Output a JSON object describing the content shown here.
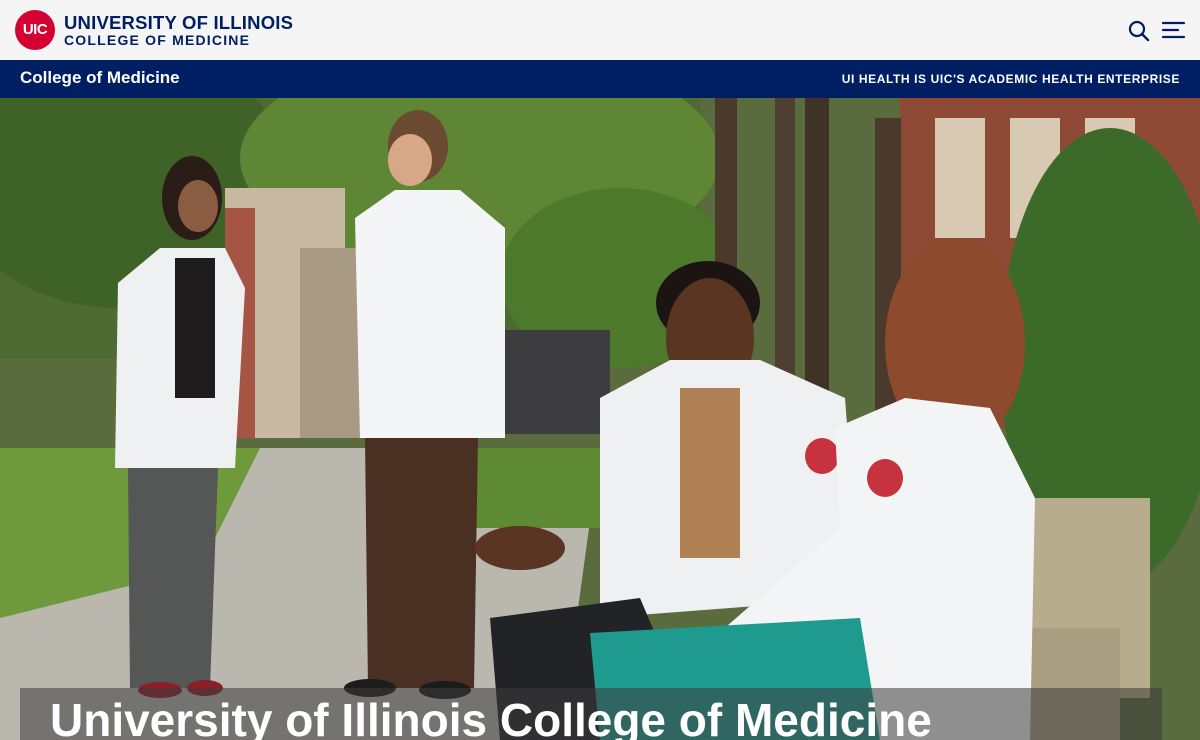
{
  "header": {
    "logo_badge": "UIC",
    "logo_line1": "UNIVERSITY OF ILLINOIS",
    "logo_line2": "COLLEGE OF MEDICINE",
    "search_icon": "search-icon",
    "menu_icon": "hamburger-menu-icon"
  },
  "subbar": {
    "title": "College of Medicine",
    "link": "UI HEALTH IS UIC'S ACADEMIC HEALTH ENTERPRISE"
  },
  "hero": {
    "headline": "University of Illinois College of Medicine"
  },
  "colors": {
    "navy": "#001e62",
    "uic_red": "#d50032",
    "header_bg": "#f5f5f5"
  }
}
